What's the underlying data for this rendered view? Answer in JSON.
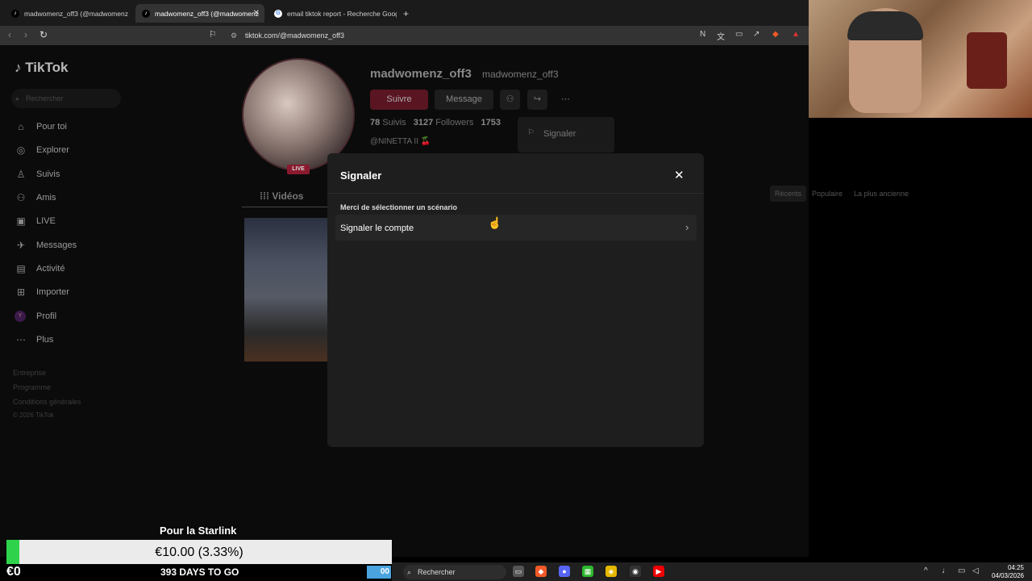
{
  "browser": {
    "tabs": [
      {
        "title": "madwomenz_off3 (@madwomenz",
        "active": false
      },
      {
        "title": "madwomenz_off3 (@madwomenz",
        "active": true
      },
      {
        "title": "email tiktok report - Recherche Goog",
        "active": false
      }
    ],
    "new_tab": "+",
    "url": "tiktok.com/@madwomenz_off3"
  },
  "sidebar": {
    "logo": "TikTok",
    "search_placeholder": "Rechercher",
    "items": [
      {
        "label": "Pour toi",
        "icon": "home-icon"
      },
      {
        "label": "Explorer",
        "icon": "compass-icon"
      },
      {
        "label": "Suivis",
        "icon": "user-follow-icon"
      },
      {
        "label": "Amis",
        "icon": "friends-icon"
      },
      {
        "label": "LIVE",
        "icon": "live-icon"
      },
      {
        "label": "Messages",
        "icon": "message-icon"
      },
      {
        "label": "Activité",
        "icon": "activity-icon"
      },
      {
        "label": "Importer",
        "icon": "upload-icon"
      },
      {
        "label": "Profil",
        "icon": "profile-avatar-icon"
      },
      {
        "label": "Plus",
        "icon": "more-icon"
      }
    ],
    "footer": [
      "Entreprise",
      "Programme",
      "Conditions générales",
      "© 2026 TikTok"
    ]
  },
  "profile": {
    "username": "madwomenz_off3",
    "handle": "madwomenz_off3",
    "follow_label": "Suivre",
    "message_label": "Message",
    "following_count": "78",
    "following_label": "Suivis",
    "followers_count": "3127",
    "followers_label": "Followers",
    "likes_count": "1753",
    "bio": "@NINETTA II 🍒",
    "live_badge": "LIVE",
    "dropdown_report": "Signaler",
    "videos_tab": "Vidéos",
    "sort": [
      "Récents",
      "Populaire",
      "La plus ancienne"
    ]
  },
  "modal": {
    "title": "Signaler",
    "close": "✕",
    "prompt": "Merci de sélectionner un scénario",
    "option": "Signaler le compte"
  },
  "overlay": {
    "title": "Pour la Starlink",
    "amount": "€10.00 (3.33%)",
    "progress_fraction": 0.0333,
    "raised": "€0",
    "days": "393 DAYS TO GO",
    "bar_color": "#2ed34b"
  },
  "taskbar": {
    "search": "Rechercher",
    "widget": "00",
    "time": "04:25",
    "date": "04/03/2026"
  }
}
